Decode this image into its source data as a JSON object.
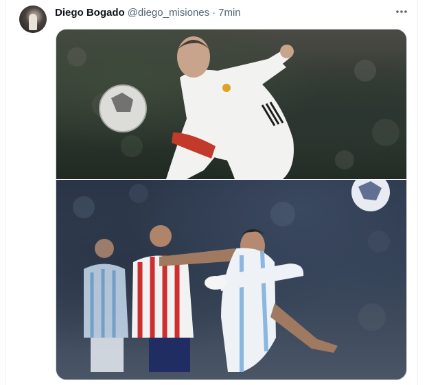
{
  "tweet": {
    "author_name": "Diego Bogado",
    "author_handle": "@diego_misiones",
    "separator": "·",
    "time": "7min",
    "more_icon": "ellipsis-icon"
  },
  "media": {
    "images": [
      {
        "subject": "player-white-kit-volley"
      },
      {
        "subject": "player-argentina-kit-volley"
      }
    ]
  }
}
